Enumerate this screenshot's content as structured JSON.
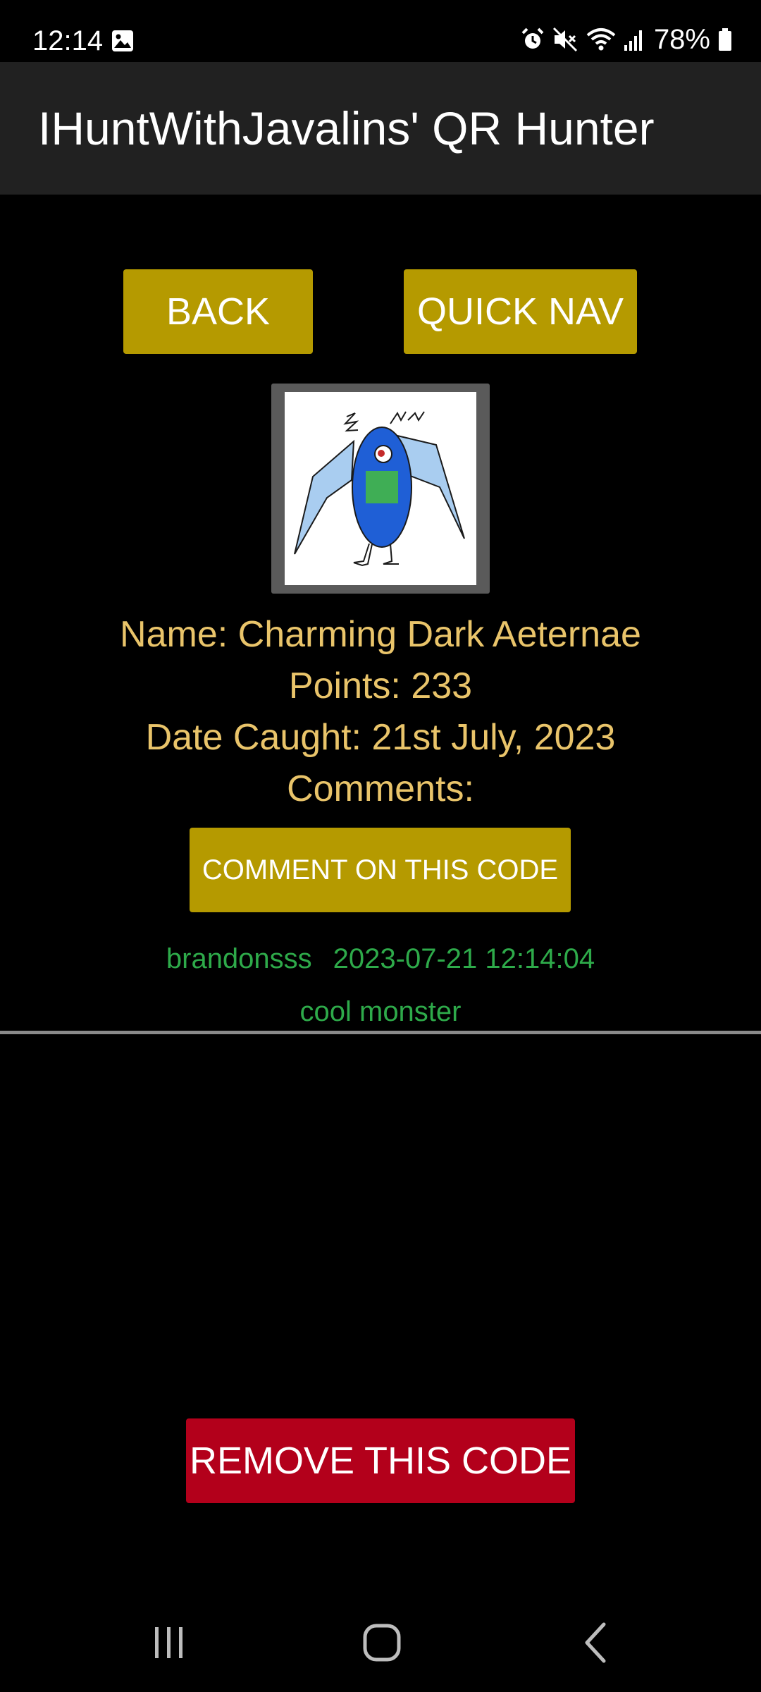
{
  "status_bar": {
    "time": "12:14",
    "battery": "78%",
    "icons": [
      "gallery-icon",
      "alarm-icon",
      "mute-icon",
      "wifi-icon",
      "signal-icon",
      "battery-icon"
    ]
  },
  "app_bar": {
    "title": "IHuntWithJavalins' QR Hunter"
  },
  "nav_buttons": {
    "back_label": "BACK",
    "quick_nav_label": "QUICK NAV"
  },
  "monster": {
    "image_icon": "monster-image"
  },
  "details": {
    "name": "Name: Charming Dark Aeternae",
    "points": "Points: 233",
    "date_caught": "Date Caught: 21st July, 2023",
    "comments_label": "Comments:"
  },
  "comment_button_label": "COMMENT ON THIS CODE",
  "comments": [
    {
      "user": "brandonsss",
      "timestamp": "2023-07-21 12:14:04",
      "text": "cool monster"
    }
  ],
  "remove_button_label": "REMOVE THIS CODE",
  "system_nav": {
    "icons": [
      "recent-apps-icon",
      "home-icon",
      "back-icon"
    ]
  },
  "colors": {
    "background": "#000000",
    "app_bar": "#212121",
    "primary_button": "#b59a00",
    "danger_button": "#b3001b",
    "info_text": "#e9c46a",
    "comment_text": "#2eaa4a"
  }
}
